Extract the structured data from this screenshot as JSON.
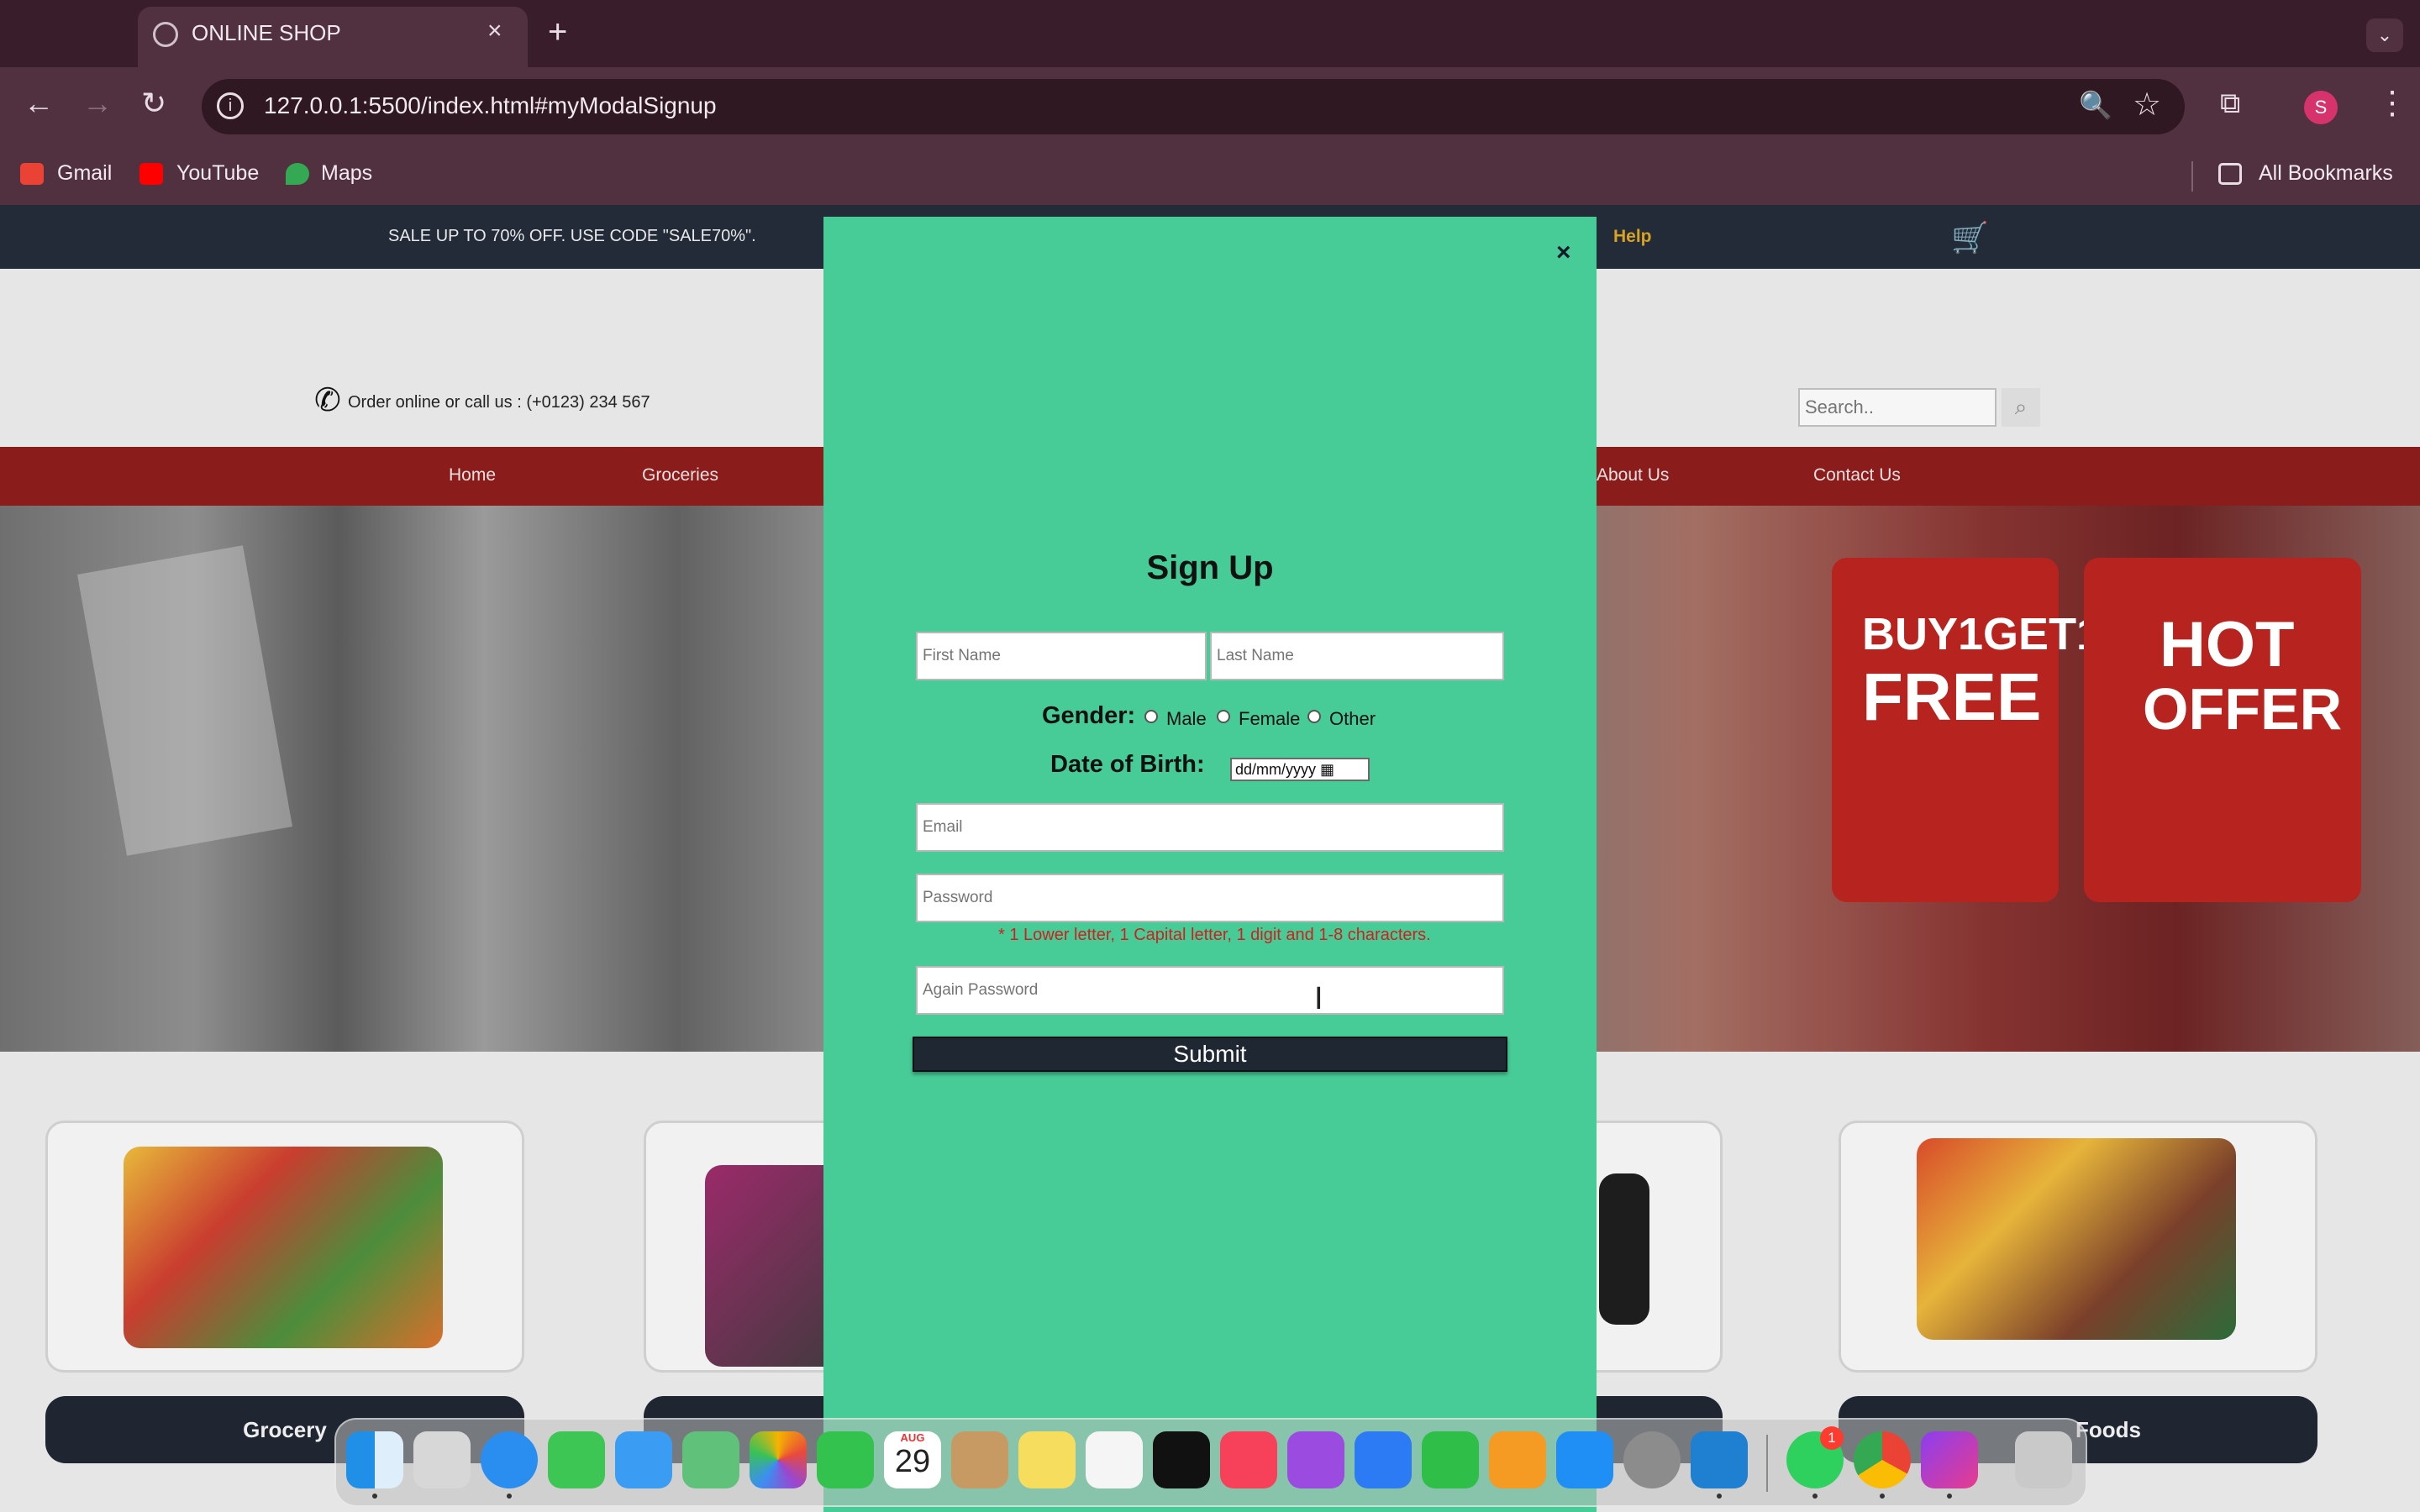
{
  "browser": {
    "tab_title": "ONLINE SHOP",
    "tab_close": "×",
    "new_tab": "+",
    "tab_list": "⌄",
    "url": "127.0.0.1:5500/index.html#myModalSignup",
    "avatar_letter": "S",
    "bookmarks": [
      {
        "label": "Gmail",
        "color": "#ea4335"
      },
      {
        "label": "YouTube",
        "color": "#ff0000"
      },
      {
        "label": "Maps",
        "color": "#34a853"
      }
    ],
    "all_bookmarks": "All Bookmarks",
    "icons": {
      "back": "←",
      "forward": "→",
      "reload": "↻",
      "site_info": "i",
      "zoom": "🔍",
      "star": "☆",
      "extensions": "⧉",
      "menu": "⋮"
    }
  },
  "site": {
    "sale_banner": "SALE UP TO 70% OFF. USE CODE \"SALE70%\".",
    "help": "Help",
    "order_text": "Order online or call us : (+0123) 234 567",
    "search_placeholder": "Search..",
    "nav": [
      "Home",
      "Groceries",
      "About Us",
      "Contact Us"
    ],
    "categories": [
      {
        "label": "Grocery"
      },
      {
        "label": ""
      },
      {
        "label": ""
      },
      {
        "label": "Foods"
      }
    ],
    "hero_text": [
      "BUY1GET1",
      "FREE",
      "HOT",
      "OFFER"
    ]
  },
  "modal": {
    "close": "×",
    "title": "Sign Up",
    "first_name_placeholder": "First Name",
    "last_name_placeholder": "Last Name",
    "gender_label": "Gender:",
    "gender_options": [
      "Male",
      "Female",
      "Other"
    ],
    "dob_label": "Date of Birth:",
    "dob_placeholder": "dd/mm/yyyy",
    "email_placeholder": "Email",
    "password_placeholder": "Password",
    "password_hint": "* 1 Lower letter, 1 Capital letter, 1 digit and 1-8 characters.",
    "again_password_placeholder": "Again Password",
    "submit": "Submit"
  },
  "dock": {
    "calendar_month": "AUG",
    "calendar_day": "29",
    "whatsapp_badge": "1"
  }
}
